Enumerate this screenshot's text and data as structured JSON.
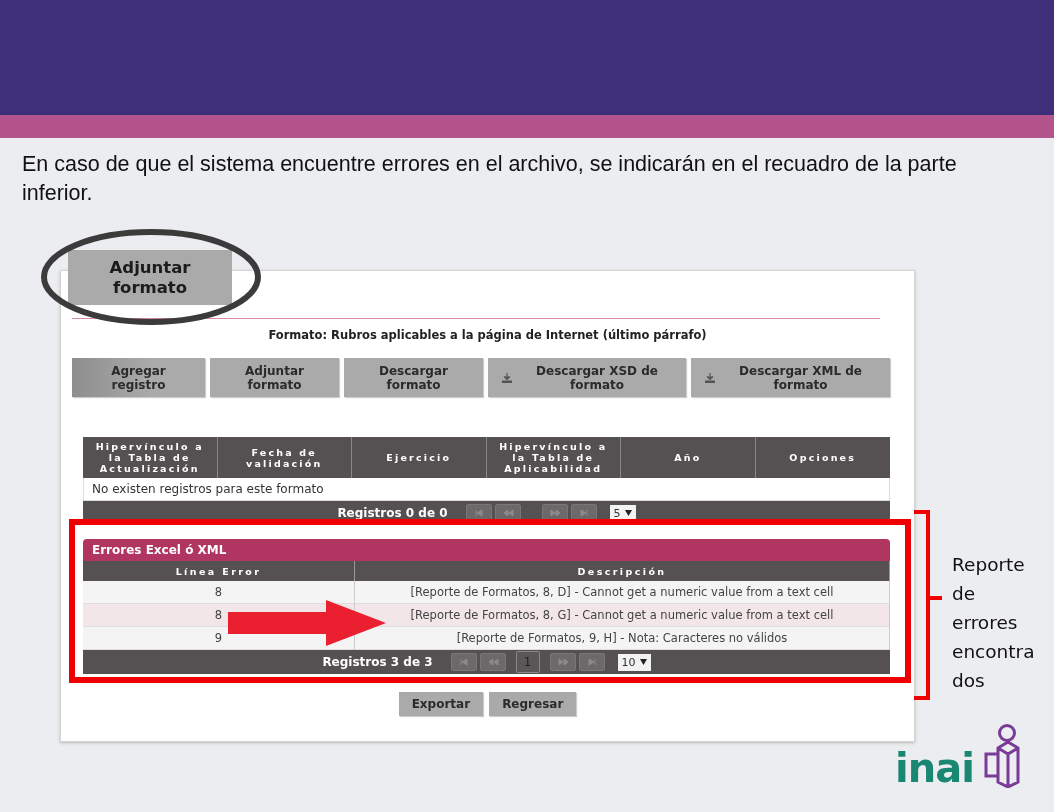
{
  "slide": {
    "intro": "En caso de que el sistema encuentre errores en el archivo, se indicarán en el recuadro de la parte inferior.",
    "side_note": [
      "Reporte",
      "de",
      "errores",
      "encontra",
      "dos"
    ],
    "logo": "inai"
  },
  "callout": {
    "label": "Adjuntar formato"
  },
  "screen": {
    "format_title": "Formato: Rubros aplicables a la página de Internet (último párrafo)",
    "buttons": [
      {
        "label": "Agregar registro",
        "kind": "plain",
        "selected": true
      },
      {
        "label": "Adjuntar formato",
        "kind": "plain",
        "selected": false
      },
      {
        "label": "Descargar formato",
        "kind": "plain",
        "selected": false
      },
      {
        "label": "Descargar XSD de formato",
        "kind": "download",
        "selected": false
      },
      {
        "label": "Descargar XML de formato",
        "kind": "download",
        "selected": false
      }
    ],
    "records": {
      "columns": [
        "Hipervínculo a la Tabla de Actualización",
        "Fecha de validación",
        "Ejercicio",
        "Hipervínculo a la Tabla de Aplicabilidad",
        "Año",
        "Opciones"
      ],
      "empty_message": "No existen registros para este formato",
      "footer": {
        "count": "Registros 0 de 0",
        "page_size": "5"
      }
    },
    "errors": {
      "title": "Errores Excel ó XML",
      "columns": [
        "Línea Error",
        "Descripción"
      ],
      "rows": [
        {
          "line": "8",
          "description": "[Reporte de Formatos, 8, D] - Cannot get a numeric value from a text cell",
          "selected": false
        },
        {
          "line": "8",
          "description": "[Reporte de Formatos, 8, G] - Cannot get a numeric value from a text cell",
          "selected": true
        },
        {
          "line": "9",
          "description": "[Reporte de Formatos, 9, H] - Nota: Caracteres no válidos",
          "selected": false
        }
      ],
      "footer": {
        "count": "Registros 3 de 3",
        "page": "1",
        "page_size": "10"
      }
    },
    "actions": [
      "Exportar",
      "Regresar"
    ]
  }
}
